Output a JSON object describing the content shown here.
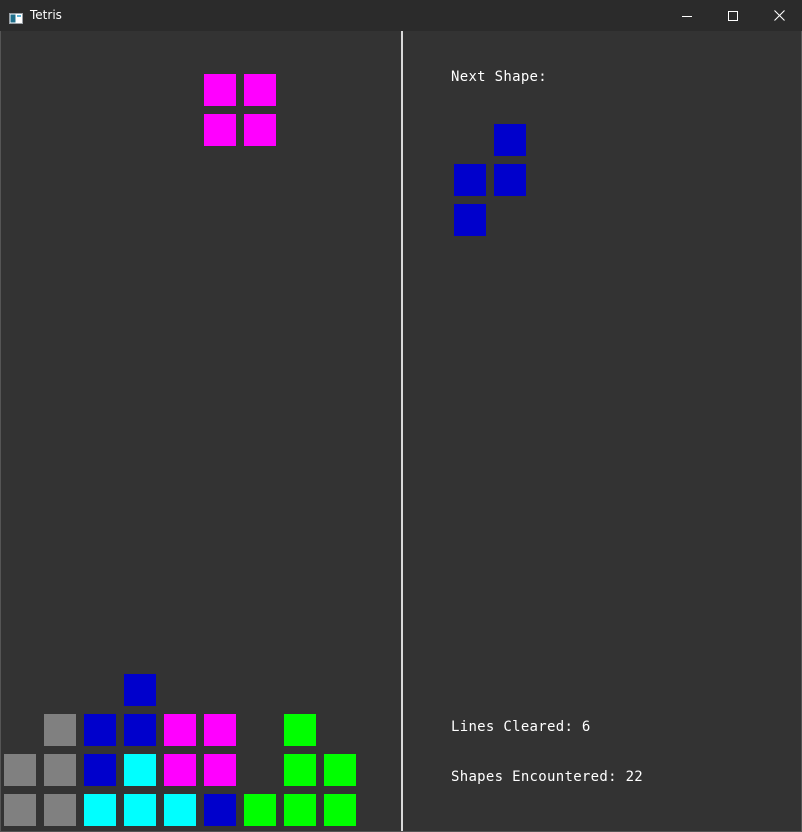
{
  "window": {
    "title": "Tetris",
    "icon": "app-window-icon",
    "controls": [
      "minimize-icon",
      "maximize-icon",
      "close-icon"
    ]
  },
  "colors": {
    "background": "#333333",
    "divider": "#d9d9d9",
    "magenta": "#ff00ff",
    "blue": "#0000cc",
    "cyan": "#00ffff",
    "green": "#00ff00",
    "gray": "#808080"
  },
  "board": {
    "columns": 10,
    "rows": 20,
    "falling_piece": {
      "shape": "O",
      "color": "#ff00ff",
      "cells": [
        [
          5,
          1
        ],
        [
          6,
          1
        ],
        [
          5,
          2
        ],
        [
          6,
          2
        ]
      ]
    },
    "settled": [
      {
        "col": 3,
        "row": 16,
        "color": "#0000cc"
      },
      {
        "col": 1,
        "row": 17,
        "color": "#808080"
      },
      {
        "col": 2,
        "row": 17,
        "color": "#0000cc"
      },
      {
        "col": 3,
        "row": 17,
        "color": "#0000cc"
      },
      {
        "col": 4,
        "row": 17,
        "color": "#ff00ff"
      },
      {
        "col": 5,
        "row": 17,
        "color": "#ff00ff"
      },
      {
        "col": 7,
        "row": 17,
        "color": "#00ff00"
      },
      {
        "col": 0,
        "row": 18,
        "color": "#808080"
      },
      {
        "col": 1,
        "row": 18,
        "color": "#808080"
      },
      {
        "col": 2,
        "row": 18,
        "color": "#0000cc"
      },
      {
        "col": 3,
        "row": 18,
        "color": "#00ffff"
      },
      {
        "col": 4,
        "row": 18,
        "color": "#ff00ff"
      },
      {
        "col": 5,
        "row": 18,
        "color": "#ff00ff"
      },
      {
        "col": 7,
        "row": 18,
        "color": "#00ff00"
      },
      {
        "col": 8,
        "row": 18,
        "color": "#00ff00"
      },
      {
        "col": 0,
        "row": 19,
        "color": "#808080"
      },
      {
        "col": 1,
        "row": 19,
        "color": "#808080"
      },
      {
        "col": 2,
        "row": 19,
        "color": "#00ffff"
      },
      {
        "col": 3,
        "row": 19,
        "color": "#00ffff"
      },
      {
        "col": 4,
        "row": 19,
        "color": "#00ffff"
      },
      {
        "col": 5,
        "row": 19,
        "color": "#0000cc"
      },
      {
        "col": 6,
        "row": 19,
        "color": "#00ff00"
      },
      {
        "col": 7,
        "row": 19,
        "color": "#00ff00"
      },
      {
        "col": 8,
        "row": 19,
        "color": "#00ff00"
      }
    ]
  },
  "side_panel": {
    "next_label": "Next Shape:",
    "next_shape": {
      "color": "#0000cc",
      "cells": [
        [
          1,
          0
        ],
        [
          0,
          1
        ],
        [
          1,
          1
        ],
        [
          0,
          2
        ]
      ]
    },
    "lines_cleared_label": "Lines Cleared: 6",
    "lines_cleared": 6,
    "shapes_label": "Shapes Encountered: 22",
    "shapes_encountered": 22
  }
}
